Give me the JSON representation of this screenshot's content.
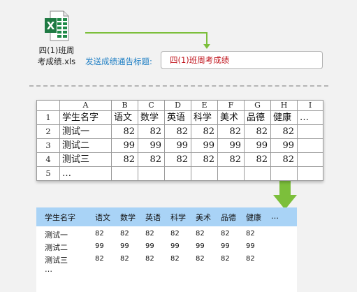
{
  "file": {
    "name_line1": "四(1)班周",
    "name_line2": "考成绩.xls"
  },
  "send": {
    "label": "发送成绩通告标题:",
    "title_value": "四(1)班周考成绩"
  },
  "sheet": {
    "columns": [
      "A",
      "B",
      "C",
      "D",
      "E",
      "F",
      "G",
      "H",
      "I"
    ],
    "rows": [
      {
        "num": "1",
        "cells": [
          "学生名字",
          "语文",
          "数学",
          "英语",
          "科学",
          "美术",
          "品德",
          "健康",
          "…"
        ]
      },
      {
        "num": "2",
        "cells": [
          "测试一",
          "82",
          "82",
          "82",
          "82",
          "82",
          "82",
          "82",
          ""
        ]
      },
      {
        "num": "3",
        "cells": [
          "测试二",
          "99",
          "99",
          "99",
          "99",
          "99",
          "99",
          "99",
          ""
        ]
      },
      {
        "num": "4",
        "cells": [
          "测试三",
          "82",
          "82",
          "82",
          "82",
          "82",
          "82",
          "82",
          ""
        ]
      },
      {
        "num": "5",
        "cells": [
          "…",
          "",
          "",
          "",
          "",
          "",
          "",
          "",
          ""
        ]
      }
    ]
  },
  "result": {
    "headers": [
      "学生名字",
      "语文",
      "数学",
      "英语",
      "科学",
      "美术",
      "品德",
      "健康",
      "…"
    ],
    "rows": [
      [
        "测试一",
        "82",
        "82",
        "82",
        "82",
        "82",
        "82",
        "82"
      ],
      [
        "测试二",
        "99",
        "99",
        "99",
        "99",
        "99",
        "99",
        "99"
      ],
      [
        "测试三",
        "82",
        "82",
        "82",
        "82",
        "82",
        "82",
        "82"
      ],
      [
        "…",
        "",
        "",
        "",
        "",
        "",
        "",
        ""
      ]
    ]
  },
  "colors": {
    "accent_green": "#7cbf3b",
    "link_blue": "#1f7fc4",
    "title_red": "#c0141c",
    "header_blue": "#a9d3f6"
  },
  "icons": {
    "file": "excel-file-icon",
    "arrow_small": "elbow-arrow-right-down",
    "arrow_big": "down-arrow"
  }
}
